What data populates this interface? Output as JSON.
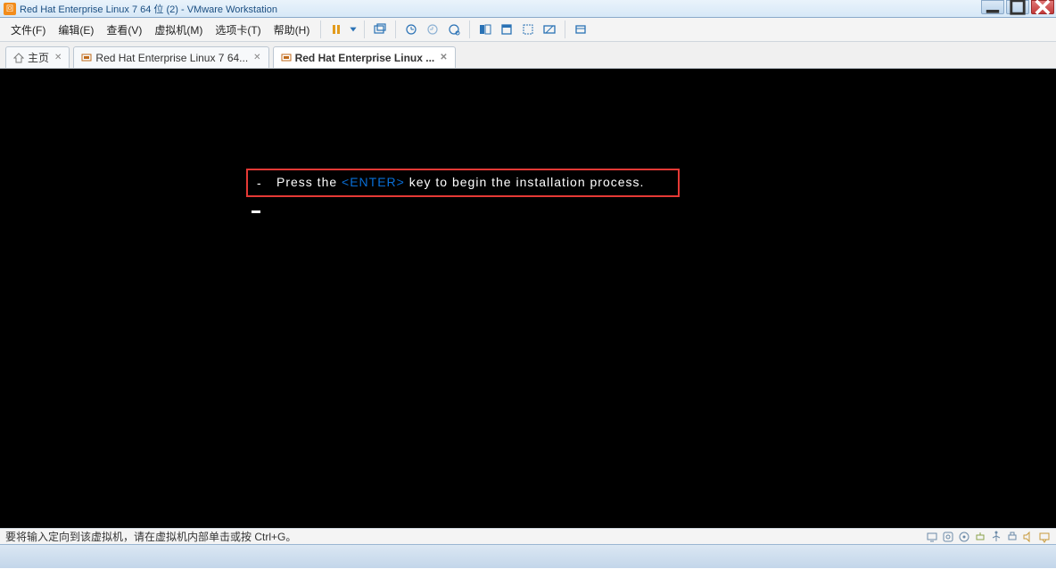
{
  "window": {
    "title": "Red Hat Enterprise Linux 7 64 位 (2) - VMware Workstation"
  },
  "menu": {
    "file": "文件(F)",
    "edit": "编辑(E)",
    "view": "查看(V)",
    "vm": "虚拟机(M)",
    "tabs": "选项卡(T)",
    "help": "帮助(H)"
  },
  "tabs": {
    "home": "主页",
    "tab1": "Red Hat Enterprise Linux 7 64...",
    "tab2": "Red Hat Enterprise Linux ..."
  },
  "console": {
    "prefix": "Press the ",
    "enter": "<ENTER>",
    "suffix": " key to begin the installation process.",
    "dash": "-"
  },
  "status": {
    "text": "要将输入定向到该虚拟机，请在虚拟机内部单击或按 Ctrl+G。"
  },
  "icons": {
    "app": "app-icon",
    "minimize": "minimize-icon",
    "maximize": "maximize-icon",
    "close": "close-icon",
    "pause": "pause-icon",
    "dropdown": "chevron-down-icon",
    "snapshot": "snapshot-icon",
    "clock1": "clock-icon",
    "clock2": "clock-back-icon",
    "clock3": "clock-gear-icon",
    "layout1": "layout-split-icon",
    "layout2": "layout-single-icon",
    "layout3": "layout-unity-icon",
    "fullscreen": "fullscreen-icon",
    "library": "library-icon",
    "home_tab": "home-icon",
    "vm_tab": "vm-icon",
    "status_monitor": "monitor-icon",
    "status_disk": "disk-icon",
    "status_cd": "cd-icon",
    "status_net": "network-icon",
    "status_usb1": "usb-icon",
    "status_usb2": "printer-icon",
    "status_sound": "sound-icon",
    "status_msg": "message-icon"
  }
}
